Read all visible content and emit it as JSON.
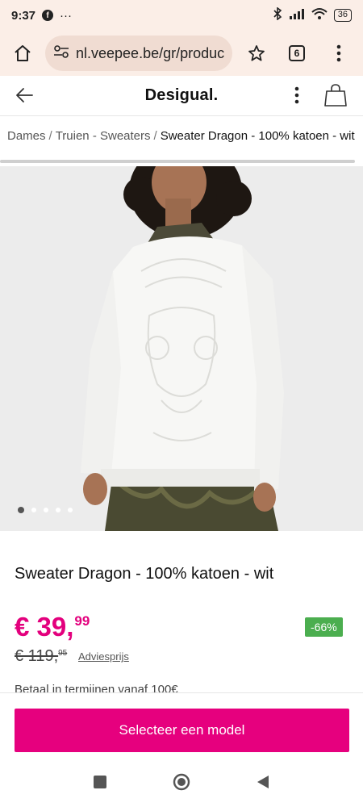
{
  "status_bar": {
    "time": "9:37",
    "notification_icon": "facebook-icon",
    "more_notifications": "···",
    "battery": "36"
  },
  "browser": {
    "url": "nl.veepee.be/gr/product",
    "tab_count": "6"
  },
  "site_header": {
    "brand": "Desigual."
  },
  "breadcrumb": {
    "items": [
      "Dames",
      "Truien - Sweaters"
    ],
    "separator": "/",
    "current": "Sweater Dragon - 100% katoen - wit"
  },
  "gallery": {
    "dots_total": 5,
    "active_index": 0
  },
  "product": {
    "title": "Sweater Dragon - 100% katoen - wit",
    "price_main": "€ 39,",
    "price_cents": "99",
    "discount": "-66%",
    "old_price_main": "€ 119,",
    "old_price_cents": "95",
    "old_price_label": "Adviesprijs",
    "installments": "Betaal in termijnen vanaf 100€"
  },
  "cta": {
    "label": "Selecteer een model"
  },
  "colors": {
    "accent": "#e6007e",
    "discount_bg": "#4bae4f",
    "browser_bg": "#fbeee7"
  }
}
